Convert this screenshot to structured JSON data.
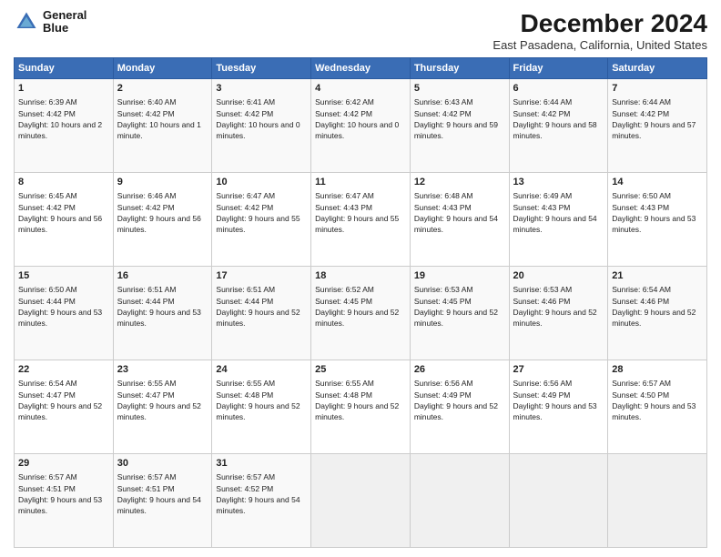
{
  "logo": {
    "line1": "General",
    "line2": "Blue"
  },
  "title": "December 2024",
  "subtitle": "East Pasadena, California, United States",
  "header": {
    "days": [
      "Sunday",
      "Monday",
      "Tuesday",
      "Wednesday",
      "Thursday",
      "Friday",
      "Saturday"
    ]
  },
  "weeks": [
    [
      {
        "day": "1",
        "sunrise": "6:39 AM",
        "sunset": "4:42 PM",
        "daylight": "10 hours and 2 minutes."
      },
      {
        "day": "2",
        "sunrise": "6:40 AM",
        "sunset": "4:42 PM",
        "daylight": "10 hours and 1 minute."
      },
      {
        "day": "3",
        "sunrise": "6:41 AM",
        "sunset": "4:42 PM",
        "daylight": "10 hours and 0 minutes."
      },
      {
        "day": "4",
        "sunrise": "6:42 AM",
        "sunset": "4:42 PM",
        "daylight": "10 hours and 0 minutes."
      },
      {
        "day": "5",
        "sunrise": "6:43 AM",
        "sunset": "4:42 PM",
        "daylight": "9 hours and 59 minutes."
      },
      {
        "day": "6",
        "sunrise": "6:44 AM",
        "sunset": "4:42 PM",
        "daylight": "9 hours and 58 minutes."
      },
      {
        "day": "7",
        "sunrise": "6:44 AM",
        "sunset": "4:42 PM",
        "daylight": "9 hours and 57 minutes."
      }
    ],
    [
      {
        "day": "8",
        "sunrise": "6:45 AM",
        "sunset": "4:42 PM",
        "daylight": "9 hours and 56 minutes."
      },
      {
        "day": "9",
        "sunrise": "6:46 AM",
        "sunset": "4:42 PM",
        "daylight": "9 hours and 56 minutes."
      },
      {
        "day": "10",
        "sunrise": "6:47 AM",
        "sunset": "4:42 PM",
        "daylight": "9 hours and 55 minutes."
      },
      {
        "day": "11",
        "sunrise": "6:47 AM",
        "sunset": "4:43 PM",
        "daylight": "9 hours and 55 minutes."
      },
      {
        "day": "12",
        "sunrise": "6:48 AM",
        "sunset": "4:43 PM",
        "daylight": "9 hours and 54 minutes."
      },
      {
        "day": "13",
        "sunrise": "6:49 AM",
        "sunset": "4:43 PM",
        "daylight": "9 hours and 54 minutes."
      },
      {
        "day": "14",
        "sunrise": "6:50 AM",
        "sunset": "4:43 PM",
        "daylight": "9 hours and 53 minutes."
      }
    ],
    [
      {
        "day": "15",
        "sunrise": "6:50 AM",
        "sunset": "4:44 PM",
        "daylight": "9 hours and 53 minutes."
      },
      {
        "day": "16",
        "sunrise": "6:51 AM",
        "sunset": "4:44 PM",
        "daylight": "9 hours and 53 minutes."
      },
      {
        "day": "17",
        "sunrise": "6:51 AM",
        "sunset": "4:44 PM",
        "daylight": "9 hours and 52 minutes."
      },
      {
        "day": "18",
        "sunrise": "6:52 AM",
        "sunset": "4:45 PM",
        "daylight": "9 hours and 52 minutes."
      },
      {
        "day": "19",
        "sunrise": "6:53 AM",
        "sunset": "4:45 PM",
        "daylight": "9 hours and 52 minutes."
      },
      {
        "day": "20",
        "sunrise": "6:53 AM",
        "sunset": "4:46 PM",
        "daylight": "9 hours and 52 minutes."
      },
      {
        "day": "21",
        "sunrise": "6:54 AM",
        "sunset": "4:46 PM",
        "daylight": "9 hours and 52 minutes."
      }
    ],
    [
      {
        "day": "22",
        "sunrise": "6:54 AM",
        "sunset": "4:47 PM",
        "daylight": "9 hours and 52 minutes."
      },
      {
        "day": "23",
        "sunrise": "6:55 AM",
        "sunset": "4:47 PM",
        "daylight": "9 hours and 52 minutes."
      },
      {
        "day": "24",
        "sunrise": "6:55 AM",
        "sunset": "4:48 PM",
        "daylight": "9 hours and 52 minutes."
      },
      {
        "day": "25",
        "sunrise": "6:55 AM",
        "sunset": "4:48 PM",
        "daylight": "9 hours and 52 minutes."
      },
      {
        "day": "26",
        "sunrise": "6:56 AM",
        "sunset": "4:49 PM",
        "daylight": "9 hours and 52 minutes."
      },
      {
        "day": "27",
        "sunrise": "6:56 AM",
        "sunset": "4:49 PM",
        "daylight": "9 hours and 53 minutes."
      },
      {
        "day": "28",
        "sunrise": "6:57 AM",
        "sunset": "4:50 PM",
        "daylight": "9 hours and 53 minutes."
      }
    ],
    [
      {
        "day": "29",
        "sunrise": "6:57 AM",
        "sunset": "4:51 PM",
        "daylight": "9 hours and 53 minutes."
      },
      {
        "day": "30",
        "sunrise": "6:57 AM",
        "sunset": "4:51 PM",
        "daylight": "9 hours and 54 minutes."
      },
      {
        "day": "31",
        "sunrise": "6:57 AM",
        "sunset": "4:52 PM",
        "daylight": "9 hours and 54 minutes."
      },
      null,
      null,
      null,
      null
    ]
  ]
}
